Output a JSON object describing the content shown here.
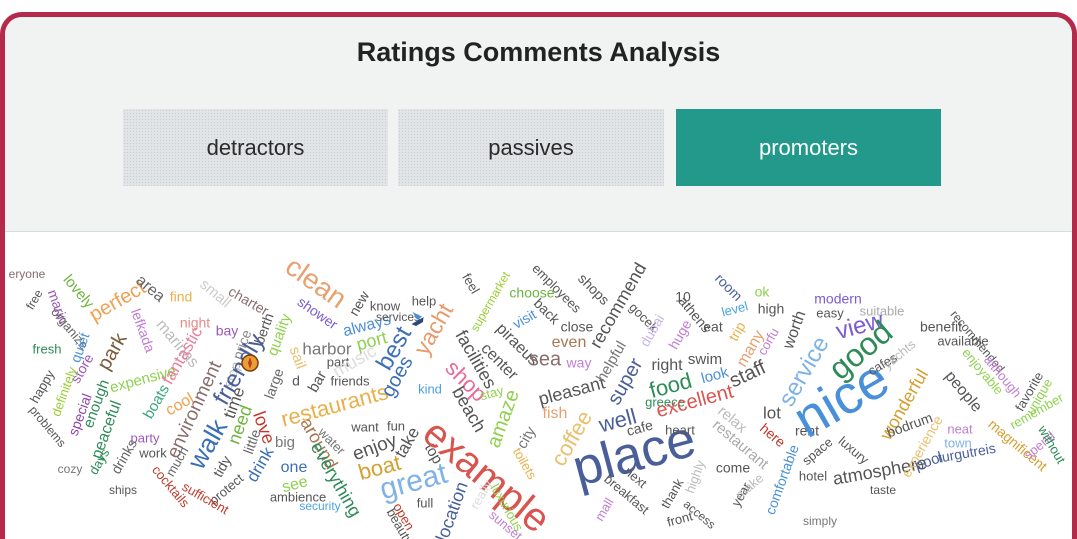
{
  "title": "Ratings Comments Analysis",
  "tabs": [
    {
      "label": "detractors",
      "active": false
    },
    {
      "label": "passives",
      "active": false
    },
    {
      "label": "promoters",
      "active": true
    }
  ],
  "colors": {
    "frame_border": "#b5294b",
    "header_bg": "#f1f3f3",
    "active_tab": "#23998b"
  },
  "word_cloud": {
    "words": [
      {
        "text": "eryone",
        "color": "#8a6d6d"
      },
      {
        "text": "free",
        "color": "#555555"
      },
      {
        "text": "lovely",
        "color": "#6cb43f"
      },
      {
        "text": "marin",
        "color": "#9b59b6"
      },
      {
        "text": "organize",
        "color": "#666666"
      },
      {
        "text": "fresh",
        "color": "#2e8b57"
      },
      {
        "text": "quiet",
        "color": "#4a90d9"
      },
      {
        "text": "store",
        "color": "#9b59b6"
      },
      {
        "text": "happy",
        "color": "#555555"
      },
      {
        "text": "definitely",
        "color": "#9acd32"
      },
      {
        "text": "special",
        "color": "#8e44ad"
      },
      {
        "text": "problems",
        "color": "#555555"
      },
      {
        "text": "enough",
        "color": "#2e8b57"
      },
      {
        "text": "peaceful",
        "color": "#2e8b57"
      },
      {
        "text": "perfect",
        "color": "#f0a050"
      },
      {
        "text": "park",
        "color": "#7a5c3a"
      },
      {
        "text": "lefkada",
        "color": "#c27ed1"
      },
      {
        "text": "expensive",
        "color": "#8fd14f"
      },
      {
        "text": "boats",
        "color": "#3aa57a"
      },
      {
        "text": "party",
        "color": "#9b59b6"
      },
      {
        "text": "work",
        "color": "#555555"
      },
      {
        "text": "drinks",
        "color": "#666666"
      },
      {
        "text": "days",
        "color": "#2e8b57"
      },
      {
        "text": "cozy",
        "color": "#777777"
      },
      {
        "text": "ships",
        "color": "#555555"
      },
      {
        "text": "area",
        "color": "#666666"
      },
      {
        "text": "find",
        "color": "#e8b04a"
      },
      {
        "text": "night",
        "color": "#e38b8b"
      },
      {
        "text": "marinas",
        "color": "#bbbbbb"
      },
      {
        "text": "fantastic",
        "color": "#e77f9a"
      },
      {
        "text": "cool",
        "color": "#f0a050"
      },
      {
        "text": "environment",
        "color": "#8a6d6d"
      },
      {
        "text": "much",
        "color": "#666666"
      },
      {
        "text": "cocktails",
        "color": "#c0392b"
      },
      {
        "text": "small",
        "color": "#cccccc"
      },
      {
        "text": "bay",
        "color": "#9b59b6"
      },
      {
        "text": "price",
        "color": "#888888"
      },
      {
        "text": "stop",
        "color": "#bbbbbb"
      },
      {
        "text": "walk",
        "color": "#3b6fb6"
      },
      {
        "text": "time",
        "color": "#555555"
      },
      {
        "text": "need",
        "color": "#6cb43f"
      },
      {
        "text": "tidy",
        "color": "#555555"
      },
      {
        "text": "protect",
        "color": "#555555"
      },
      {
        "text": "sufficient",
        "color": "#c0392b"
      },
      {
        "text": "charter",
        "color": "#8a6d6d"
      },
      {
        "text": "berth",
        "color": "#555555"
      },
      {
        "text": "quality",
        "color": "#8fd14f"
      },
      {
        "text": "friendly",
        "color": "#4a5f9a"
      },
      {
        "text": "love",
        "color": "#c0392b"
      },
      {
        "text": "little",
        "color": "#666666"
      },
      {
        "text": "drink",
        "color": "#3b6fb6"
      },
      {
        "text": "large",
        "color": "#666666"
      },
      {
        "text": "d",
        "color": "#555555"
      },
      {
        "text": "big",
        "color": "#777777"
      },
      {
        "text": "one",
        "color": "#3b6fb6"
      },
      {
        "text": "see",
        "color": "#8fd14f"
      },
      {
        "text": "ambience",
        "color": "#555555"
      },
      {
        "text": "security",
        "color": "#4aa3df"
      },
      {
        "text": "clean",
        "color": "#e8a070"
      },
      {
        "text": "shower",
        "color": "#7a5cd1"
      },
      {
        "text": "sail",
        "color": "#e8c070"
      },
      {
        "text": "bar",
        "color": "#555555"
      },
      {
        "text": "harbor",
        "color": "#777777"
      },
      {
        "text": "part",
        "color": "#555555"
      },
      {
        "text": "friends",
        "color": "#555555"
      },
      {
        "text": "music",
        "color": "#dddddd"
      },
      {
        "text": "restaurants",
        "color": "#e8b04a"
      },
      {
        "text": "around",
        "color": "#a87850"
      },
      {
        "text": "water",
        "color": "#777777"
      },
      {
        "text": "everything",
        "color": "#2e8b57"
      },
      {
        "text": "new",
        "color": "#555555"
      },
      {
        "text": "always",
        "color": "#4a90d9"
      },
      {
        "text": "port",
        "color": "#8fd14f"
      },
      {
        "text": "know",
        "color": "#555555"
      },
      {
        "text": "services",
        "color": "#555555"
      },
      {
        "text": "help",
        "color": "#555555"
      },
      {
        "text": "best",
        "color": "#3b6fb6"
      },
      {
        "text": "goes",
        "color": "#3b6fb6"
      },
      {
        "text": "want",
        "color": "#555555"
      },
      {
        "text": "fun",
        "color": "#555555"
      },
      {
        "text": "enjoy",
        "color": "#555555"
      },
      {
        "text": "boat",
        "color": "#d4a030"
      },
      {
        "text": "take",
        "color": "#555555"
      },
      {
        "text": "great",
        "color": "#7fb3e8"
      },
      {
        "text": "open",
        "color": "#c0392b"
      },
      {
        "text": "beauty",
        "color": "#555555"
      },
      {
        "text": "yacht",
        "color": "#e89a6a"
      },
      {
        "text": "kind",
        "color": "#4aa3df"
      },
      {
        "text": "shop",
        "color": "#e86a9a"
      },
      {
        "text": "top",
        "color": "#555555"
      },
      {
        "text": "full",
        "color": "#555555"
      },
      {
        "text": "example",
        "color": "#d9534f"
      },
      {
        "text": "location",
        "color": "#4a5f9a"
      },
      {
        "text": "feel",
        "color": "#555555"
      },
      {
        "text": "facilities",
        "color": "#555555"
      },
      {
        "text": "beach",
        "color": "#555555"
      },
      {
        "text": "stay",
        "color": "#8fd14f"
      },
      {
        "text": "really",
        "color": "#dddddd"
      },
      {
        "text": "supermarket",
        "color": "#9acd32"
      },
      {
        "text": "center",
        "color": "#555555"
      },
      {
        "text": "piraeus",
        "color": "#555555"
      },
      {
        "text": "visit",
        "color": "#4a90d9"
      },
      {
        "text": "amaze",
        "color": "#8fd14f"
      },
      {
        "text": "city",
        "color": "#777777"
      },
      {
        "text": "toilets",
        "color": "#e8b04a"
      },
      {
        "text": "luxurious",
        "color": "#8fd14f"
      },
      {
        "text": "sunset",
        "color": "#c27ed1"
      },
      {
        "text": "choose",
        "color": "#6cb43f"
      },
      {
        "text": "employees",
        "color": "#555555"
      },
      {
        "text": "back",
        "color": "#555555"
      },
      {
        "text": "sea",
        "color": "#8a6d6d"
      },
      {
        "text": "even",
        "color": "#a87850"
      },
      {
        "text": "close",
        "color": "#555555"
      },
      {
        "text": "way",
        "color": "#c27ed1"
      },
      {
        "text": "pleasant",
        "color": "#555555"
      },
      {
        "text": "fish",
        "color": "#e8a070"
      },
      {
        "text": "coffee",
        "color": "#e8c070"
      },
      {
        "text": "shops",
        "color": "#555555"
      },
      {
        "text": "recommend",
        "color": "#555555"
      },
      {
        "text": "helpful",
        "color": "#777777"
      },
      {
        "text": "super",
        "color": "#4a5f9a"
      },
      {
        "text": "well",
        "color": "#4a5f9a"
      },
      {
        "text": "place",
        "color": "#4a5f9a"
      },
      {
        "text": "cafe",
        "color": "#555555"
      },
      {
        "text": "next",
        "color": "#555555"
      },
      {
        "text": "breakfast",
        "color": "#555555"
      },
      {
        "text": "mall",
        "color": "#c27ed1"
      },
      {
        "text": "gocek",
        "color": "#555555"
      },
      {
        "text": "dubai",
        "color": "#c8b8e8"
      },
      {
        "text": "10",
        "color": "#555555"
      },
      {
        "text": "athens",
        "color": "#555555"
      },
      {
        "text": "huge",
        "color": "#c27ed1"
      },
      {
        "text": "right",
        "color": "#555555"
      },
      {
        "text": "food",
        "color": "#2e8b57"
      },
      {
        "text": "greece",
        "color": "#2e8b57"
      },
      {
        "text": "excellent",
        "color": "#d9534f"
      },
      {
        "text": "heart",
        "color": "#555555"
      },
      {
        "text": "thank",
        "color": "#555555"
      },
      {
        "text": "front",
        "color": "#555555"
      },
      {
        "text": "eat",
        "color": "#555555"
      },
      {
        "text": "swim",
        "color": "#555555"
      },
      {
        "text": "look",
        "color": "#4a90d9"
      },
      {
        "text": "highly",
        "color": "#bbbbbb"
      },
      {
        "text": "access",
        "color": "#555555"
      },
      {
        "text": "room",
        "color": "#4a5f9a"
      },
      {
        "text": "trip",
        "color": "#e8b04a"
      },
      {
        "text": "level",
        "color": "#4aa3df"
      },
      {
        "text": "ok",
        "color": "#8fd14f"
      },
      {
        "text": "many",
        "color": "#e8a070"
      },
      {
        "text": "high",
        "color": "#555555"
      },
      {
        "text": "staff",
        "color": "#555555"
      },
      {
        "text": "relax",
        "color": "#bbbbbb"
      },
      {
        "text": "restaurant",
        "color": "#aaaaaa"
      },
      {
        "text": "come",
        "color": "#555555"
      },
      {
        "text": "year",
        "color": "#555555"
      },
      {
        "text": "make",
        "color": "#bbbbbb"
      },
      {
        "text": "corfu",
        "color": "#c27ed1"
      },
      {
        "text": "lot",
        "color": "#555555"
      },
      {
        "text": "here",
        "color": "#c0392b"
      },
      {
        "text": "comfortable",
        "color": "#4a90d9"
      },
      {
        "text": "worth",
        "color": "#555555"
      },
      {
        "text": "service",
        "color": "#7fb3e8"
      },
      {
        "text": "rent",
        "color": "#555555"
      },
      {
        "text": "space",
        "color": "#555555"
      },
      {
        "text": "hotel",
        "color": "#555555"
      },
      {
        "text": "simply",
        "color": "#777777"
      },
      {
        "text": "nice",
        "color": "#4a90d9"
      },
      {
        "text": "modern",
        "color": "#7a5cd1"
      },
      {
        "text": "easy",
        "color": "#555555"
      },
      {
        "text": "view",
        "color": "#7a5cd1"
      },
      {
        "text": "luxury",
        "color": "#555555"
      },
      {
        "text": "good",
        "color": "#2e8b57"
      },
      {
        "text": "suitable",
        "color": "#aaaaaa"
      },
      {
        "text": "atmosphere",
        "color": "#555555"
      },
      {
        "text": "cafes",
        "color": "#555555"
      },
      {
        "text": "yachts",
        "color": "#bbbbbb"
      },
      {
        "text": "wonderful",
        "color": "#d4a030"
      },
      {
        "text": "experience",
        "color": "#e8c070"
      },
      {
        "text": "bodrum",
        "color": "#555555"
      },
      {
        "text": "pool",
        "color": "#4a5f9a"
      },
      {
        "text": "taste",
        "color": "#555555"
      },
      {
        "text": "turgutreis",
        "color": "#4a5f9a"
      },
      {
        "text": "town",
        "color": "#7fb3e8"
      },
      {
        "text": "benefit",
        "color": "#555555"
      },
      {
        "text": "available",
        "color": "#555555"
      },
      {
        "text": "people",
        "color": "#555555"
      },
      {
        "text": "neat",
        "color": "#c27ed1"
      },
      {
        "text": "recommended",
        "color": "#555555"
      },
      {
        "text": "enjoyable",
        "color": "#8fd14f"
      },
      {
        "text": "although",
        "color": "#c27ed1"
      },
      {
        "text": "magnificent",
        "color": "#d4a030"
      },
      {
        "text": "favorite",
        "color": "#555555"
      },
      {
        "text": "unique",
        "color": "#8fd14f"
      },
      {
        "text": "remember",
        "color": "#8fd14f"
      },
      {
        "text": "spend",
        "color": "#c27ed1"
      },
      {
        "text": "without",
        "color": "#2e8b57"
      }
    ]
  }
}
